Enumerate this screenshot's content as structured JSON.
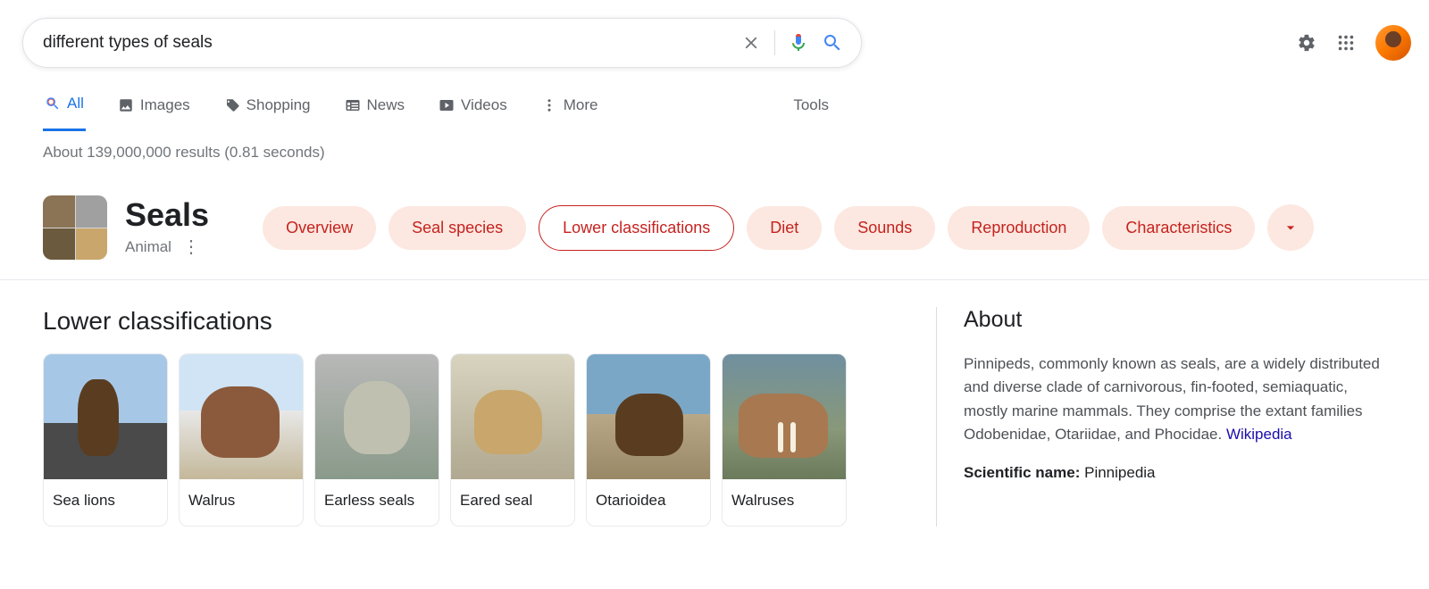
{
  "search": {
    "query": "different types of seals"
  },
  "tabs": {
    "all": "All",
    "images": "Images",
    "shopping": "Shopping",
    "news": "News",
    "videos": "Videos",
    "more": "More",
    "tools": "Tools"
  },
  "result_stats": "About 139,000,000 results (0.81 seconds)",
  "kp": {
    "title": "Seals",
    "subtitle": "Animal",
    "chips": [
      "Overview",
      "Seal species",
      "Lower classifications",
      "Diet",
      "Sounds",
      "Reproduction",
      "Characteristics"
    ],
    "active_chip_index": 2
  },
  "section": {
    "title": "Lower classifications",
    "cards": [
      "Sea lions",
      "Walrus",
      "Earless seals",
      "Eared seal",
      "Otarioidea",
      "Walruses"
    ]
  },
  "about": {
    "title": "About",
    "text": "Pinnipeds, commonly known as seals, are a widely distributed and diverse clade of carnivorous, fin-footed, semiaquatic, mostly marine mammals. They comprise the extant families Odobenidae, Otariidae, and Phocidae. ",
    "source": "Wikipedia",
    "fact_label": "Scientific name:",
    "fact_value": "Pinnipedia"
  }
}
